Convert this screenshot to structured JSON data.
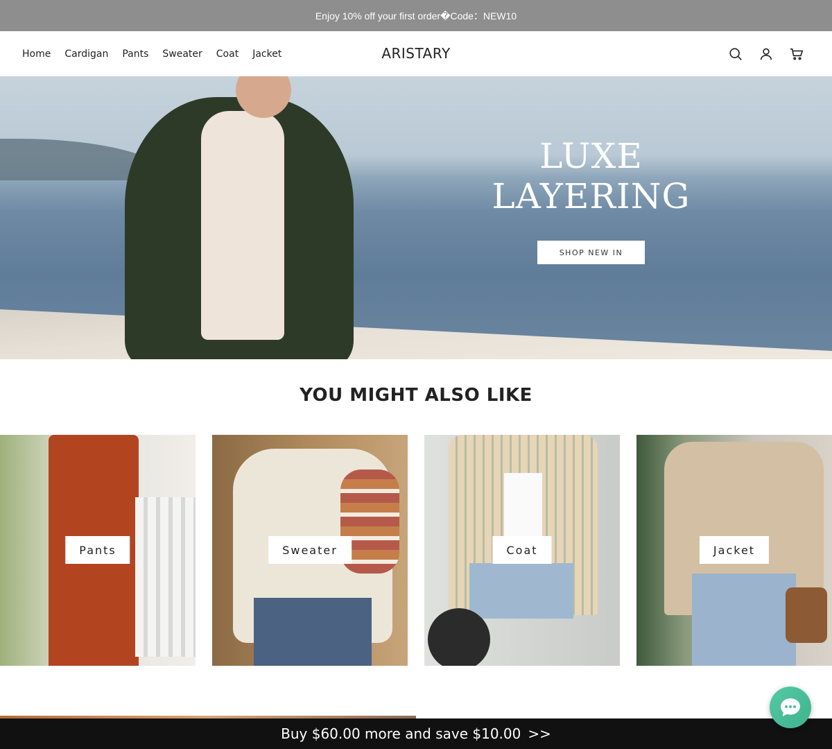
{
  "announcement": {
    "text": "Enjoy 10% off your first order�Code：NEW10"
  },
  "nav": {
    "items": [
      {
        "label": "Home"
      },
      {
        "label": "Cardigan"
      },
      {
        "label": "Pants"
      },
      {
        "label": "Sweater"
      },
      {
        "label": "Coat"
      },
      {
        "label": "Jacket"
      }
    ]
  },
  "brand": {
    "name": "ARISTARY"
  },
  "header_icons": [
    "search-icon",
    "account-icon",
    "cart-icon"
  ],
  "hero": {
    "title_line1": "LUXE",
    "title_line2": "LAYERING",
    "button_label": "SHOP NEW IN"
  },
  "recommendations": {
    "title": "YOU MIGHT ALSO LIKE",
    "cards": [
      {
        "label": "Pants"
      },
      {
        "label": "Sweater"
      },
      {
        "label": "Coat"
      },
      {
        "label": "Jacket"
      }
    ]
  },
  "promo_bar": {
    "text": "Buy $60.00 more and save $10.00",
    "arrow": ">>"
  },
  "chat": {
    "icon": "chat-bubble-icon"
  },
  "colors": {
    "announcement_bg": "#8e8e8e",
    "promo_bar_bg": "#111111",
    "chat_button": "#4cbf99"
  }
}
